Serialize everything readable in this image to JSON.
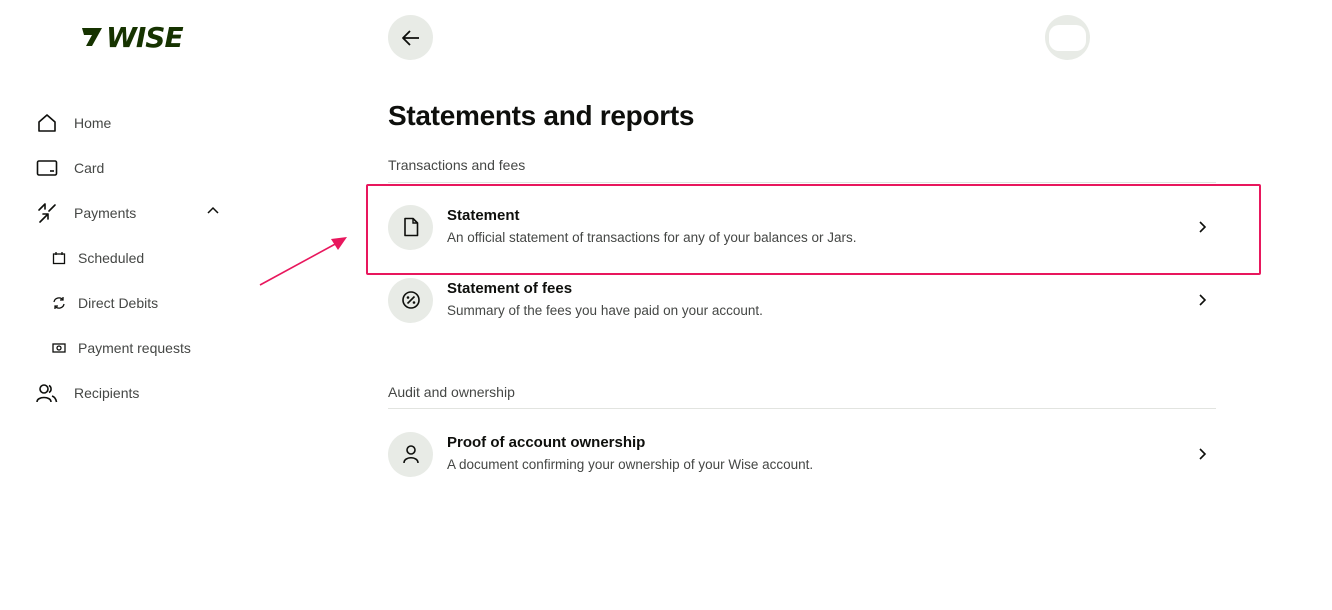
{
  "brand": {
    "logo_text": "WISE",
    "color": "#163300"
  },
  "sidebar": {
    "items": [
      {
        "label": "Home",
        "icon": "home-icon"
      },
      {
        "label": "Card",
        "icon": "card-icon"
      },
      {
        "label": "Payments",
        "icon": "payments-icon",
        "expanded": true
      },
      {
        "label": "Scheduled",
        "icon": "calendar-icon",
        "sub": true
      },
      {
        "label": "Direct Debits",
        "icon": "refresh-icon",
        "sub": true
      },
      {
        "label": "Payment requests",
        "icon": "payment-request-icon",
        "sub": true
      },
      {
        "label": "Recipients",
        "icon": "recipients-icon"
      }
    ]
  },
  "header": {
    "back_icon": "arrow-left-icon"
  },
  "page": {
    "title": "Statements and reports",
    "sections": [
      {
        "label": "Transactions and fees",
        "rows": [
          {
            "title": "Statement",
            "description": "An official statement of transactions for any of your balances or Jars.",
            "icon": "document-icon"
          },
          {
            "title": "Statement of fees",
            "description": "Summary of the fees you have paid on your account.",
            "icon": "percent-icon"
          }
        ]
      },
      {
        "label": "Audit and ownership",
        "rows": [
          {
            "title": "Proof of account ownership",
            "description": "A document confirming your ownership of your Wise account.",
            "icon": "person-icon"
          }
        ]
      }
    ]
  },
  "annotation": {
    "highlight_color": "#e8175d"
  }
}
